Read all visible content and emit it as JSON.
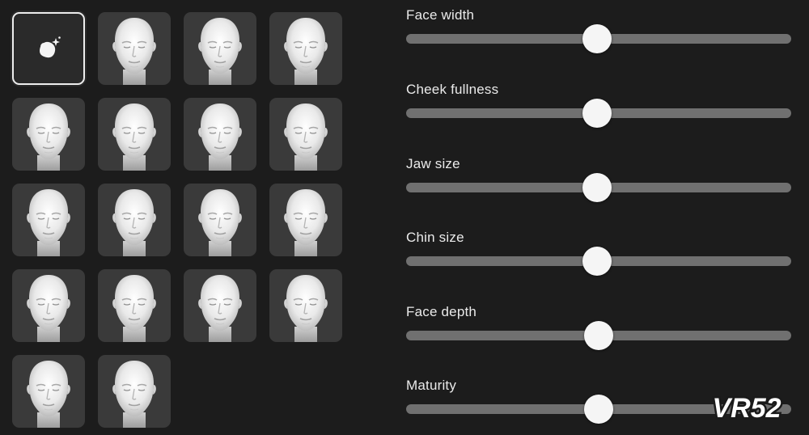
{
  "face_presets": {
    "custom_tile": {
      "icon": "custom-face-sparkle-icon",
      "selected": true
    },
    "preset_count": 17
  },
  "sliders": [
    {
      "label": "Face width",
      "value": 0.495
    },
    {
      "label": "Cheek fullness",
      "value": 0.495
    },
    {
      "label": "Jaw size",
      "value": 0.495
    },
    {
      "label": "Chin size",
      "value": 0.495
    },
    {
      "label": "Face depth",
      "value": 0.5
    },
    {
      "label": "Maturity",
      "value": 0.5
    }
  ],
  "watermark": {
    "text": "VR52"
  },
  "colors": {
    "background": "#1c1c1c",
    "tile": "#3a3a3a",
    "track": "#707070",
    "thumb": "#f5f5f5",
    "label": "#eaeaea"
  }
}
